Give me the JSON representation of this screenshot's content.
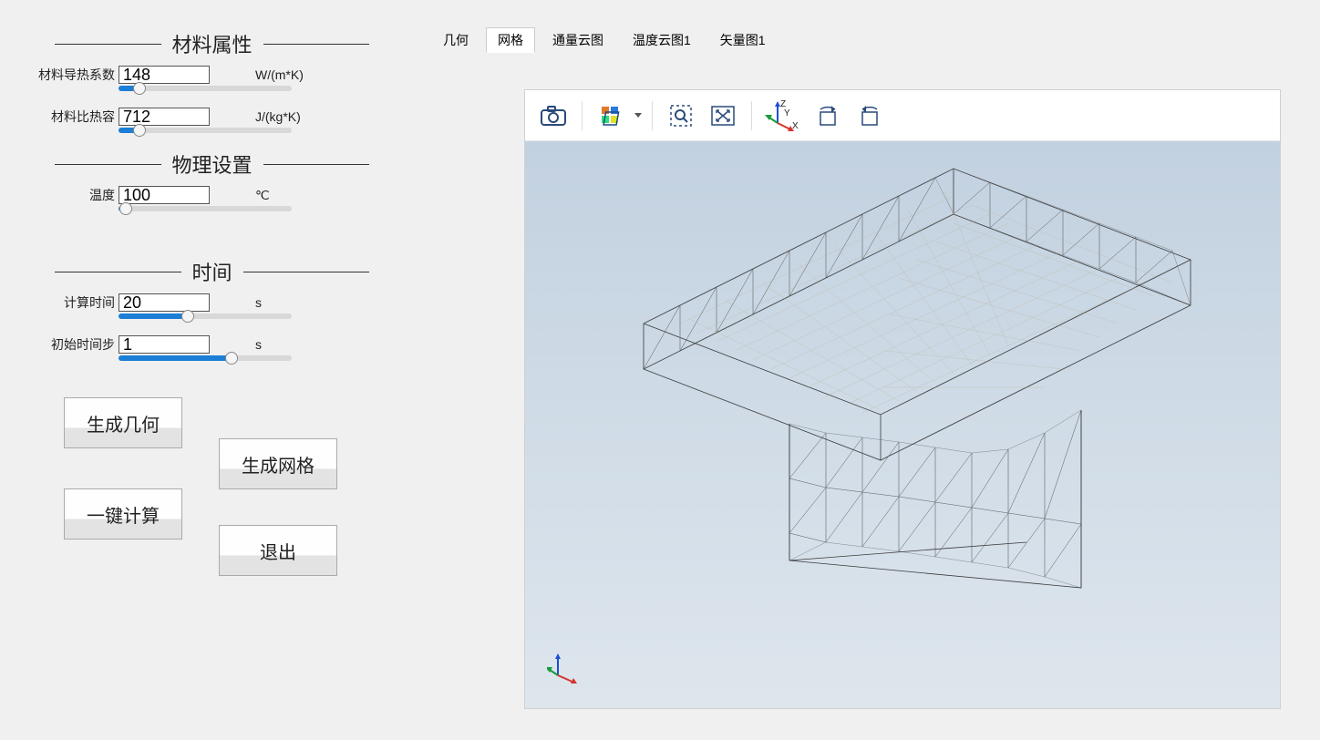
{
  "sections": {
    "material": {
      "title": "材料属性",
      "conductivity_label": "材料导热系数",
      "conductivity_value": "148",
      "conductivity_unit": "W/(m*K)",
      "heat_capacity_label": "材料比热容",
      "heat_capacity_value": "712",
      "heat_capacity_unit": "J/(kg*K)"
    },
    "physics": {
      "title": "物理设置",
      "temperature_label": "温度",
      "temperature_value": "100",
      "temperature_unit": "℃"
    },
    "time": {
      "title": "时间",
      "compute_time_label": "计算时间",
      "compute_time_value": "20",
      "compute_time_unit": "s",
      "init_step_label": "初始时间步",
      "init_step_value": "1",
      "init_step_unit": "s"
    }
  },
  "buttons": {
    "gen_geometry": "生成几何",
    "gen_mesh": "生成网格",
    "one_click_compute": "一键计算",
    "exit": "退出"
  },
  "tabs": {
    "items": [
      "几何",
      "网格",
      "通量云图",
      "温度云图1",
      "矢量图1"
    ],
    "active_index": 1
  },
  "toolbar": {
    "icons": [
      "camera-icon",
      "grid-select-icon",
      "zoom-box-icon",
      "zoom-extents-icon",
      "orientation-axes-icon",
      "rotate-cw-icon",
      "rotate-ccw-icon"
    ]
  },
  "axes": {
    "top": {
      "x": "X",
      "y": "Y",
      "z": "Z"
    }
  },
  "colors": {
    "accent": "#1c7ed6",
    "axis_x": "#d6332e",
    "axis_y": "#1a9b3a",
    "axis_z": "#1a4fd6"
  }
}
